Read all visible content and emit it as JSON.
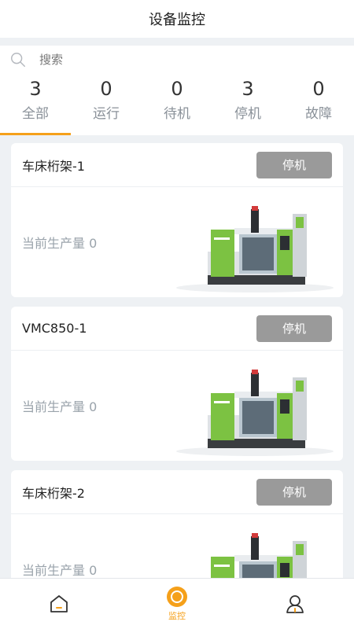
{
  "header": {
    "title": "设备监控"
  },
  "search": {
    "placeholder": "搜索",
    "icon": "search-icon"
  },
  "tabs": [
    {
      "count": "3",
      "label": "全部",
      "active": true
    },
    {
      "count": "0",
      "label": "运行",
      "active": false
    },
    {
      "count": "0",
      "label": "待机",
      "active": false
    },
    {
      "count": "3",
      "label": "停机",
      "active": false
    },
    {
      "count": "0",
      "label": "故障",
      "active": false
    }
  ],
  "devices": [
    {
      "name": "车床桁架-1",
      "status": "停机",
      "production": "当前生产量 0"
    },
    {
      "name": "VMC850-1",
      "status": "停机",
      "production": "当前生产量 0"
    },
    {
      "name": "车床桁架-2",
      "status": "停机",
      "production": "当前生产量 0"
    }
  ],
  "nav": {
    "items": [
      {
        "icon": "home-icon",
        "label": ""
      },
      {
        "icon": "monitor-icon",
        "label": "监控"
      },
      {
        "icon": "user-icon",
        "label": ""
      }
    ]
  },
  "colors": {
    "accent": "#f5a01a",
    "status_stopped": "#9a9a9a",
    "machine_green": "#7cc242"
  }
}
